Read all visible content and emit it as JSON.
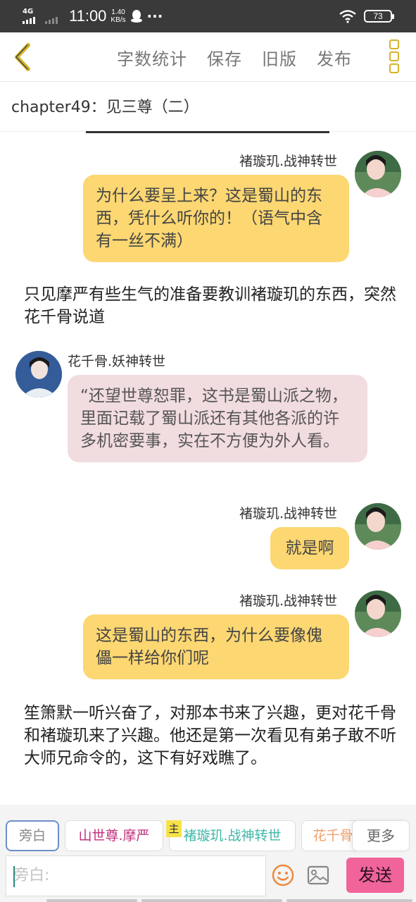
{
  "status_bar": {
    "network": "4G",
    "time": "11:00",
    "speed_value": "1.40",
    "speed_unit": "KB/s",
    "more": "···",
    "battery": "73"
  },
  "nav": {
    "word_count": "字数统计",
    "save": "保存",
    "old_version": "旧版",
    "publish": "发布"
  },
  "chapter": {
    "title": "chapter49：见三尊（二）"
  },
  "messages": [
    {
      "speaker": "褚璇玑.战神转世",
      "side": "right",
      "text": "为什么要呈上来？这是蜀山的东西，凭什么听你的！（语气中含有一丝不满）"
    },
    {
      "narration": "只见摩严有些生气的准备要教训褚璇玑的东西，突然花千骨说道"
    },
    {
      "speaker": "花千骨.妖神转世",
      "side": "left",
      "text": "“还望世尊恕罪，这书是蜀山派之物，里面记载了蜀山派还有其他各派的许多机密要事，实在不方便为外人看。"
    },
    {
      "speaker": "褚璇玑.战神转世",
      "side": "right",
      "text": "就是啊"
    },
    {
      "speaker": "褚璇玑.战神转世",
      "side": "right",
      "text": "这是蜀山的东西，为什么要像傀儡一样给你们呢"
    },
    {
      "narration": "笙箫默一听兴奋了，对那本书来了兴趣，更对花千骨和褚璇玑来了兴趣。他还是第一次看见有弟子敢不听大师兄命令的，这下有好戏瞧了。"
    }
  ],
  "roles": {
    "narrator": "旁白",
    "role1": "山世尊.摩严",
    "main_tag": "主",
    "role2": "褚璇玑.战神转世",
    "role3": "花千骨",
    "more": "更多"
  },
  "composer": {
    "placeholder": "旁白:",
    "send": "发送"
  },
  "colors": {
    "yellow_bubble": "#fcd772",
    "pink_bubble": "#f1dcdf",
    "send": "#f0649a",
    "menu": "#d4b42a"
  }
}
